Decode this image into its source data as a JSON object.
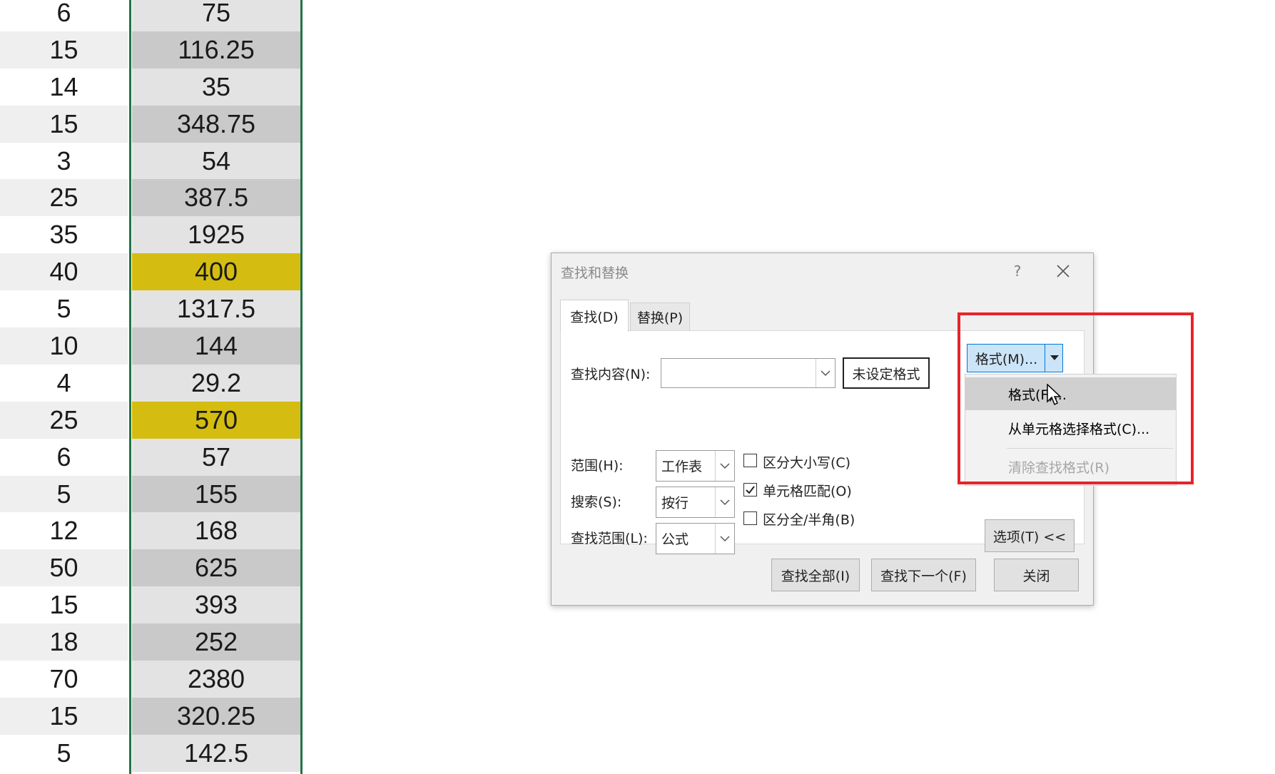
{
  "sheet": {
    "rows": [
      {
        "qty": "6",
        "amount": "75",
        "highlight": false
      },
      {
        "qty": "15",
        "amount": "116.25",
        "highlight": false
      },
      {
        "qty": "14",
        "amount": "35",
        "highlight": false
      },
      {
        "qty": "15",
        "amount": "348.75",
        "highlight": false
      },
      {
        "qty": "3",
        "amount": "54",
        "highlight": false
      },
      {
        "qty": "25",
        "amount": "387.5",
        "highlight": false
      },
      {
        "qty": "35",
        "amount": "1925",
        "highlight": false
      },
      {
        "qty": "40",
        "amount": "400",
        "highlight": true
      },
      {
        "qty": "5",
        "amount": "1317.5",
        "highlight": false
      },
      {
        "qty": "10",
        "amount": "144",
        "highlight": false
      },
      {
        "qty": "4",
        "amount": "29.2",
        "highlight": false
      },
      {
        "qty": "25",
        "amount": "570",
        "highlight": true
      },
      {
        "qty": "6",
        "amount": "57",
        "highlight": false
      },
      {
        "qty": "5",
        "amount": "155",
        "highlight": false
      },
      {
        "qty": "12",
        "amount": "168",
        "highlight": false
      },
      {
        "qty": "50",
        "amount": "625",
        "highlight": false
      },
      {
        "qty": "15",
        "amount": "393",
        "highlight": false
      },
      {
        "qty": "18",
        "amount": "252",
        "highlight": false
      },
      {
        "qty": "70",
        "amount": "2380",
        "highlight": false
      },
      {
        "qty": "15",
        "amount": "320.25",
        "highlight": false
      },
      {
        "qty": "5",
        "amount": "142.5",
        "highlight": false
      }
    ],
    "highlight_color": "#d4bd10",
    "selection_border_color": "#217346"
  },
  "dialog": {
    "title": "查找和替换",
    "help": "?",
    "tabs": {
      "find": "查找(D)",
      "replace": "替换(P)"
    },
    "find_what_label": "查找内容(N):",
    "find_what_value": "",
    "no_format_label": "未设定格式",
    "format_button_label": "格式(M)...",
    "within_label": "范围(H):",
    "within_value": "工作表",
    "search_label": "搜索(S):",
    "search_value": "按行",
    "look_in_label": "查找范围(L):",
    "look_in_value": "公式",
    "match_case_label": "区分大小写(C)",
    "match_case_checked": false,
    "match_entire_label": "单元格匹配(O)",
    "match_entire_checked": true,
    "match_byte_label": "区分全/半角(B)",
    "match_byte_checked": false,
    "options_button": "选项(T) <<",
    "find_all_button": "查找全部(I)",
    "find_next_button": "查找下一个(F)",
    "close_button": "关闭"
  },
  "format_menu": {
    "items": [
      "格式(F)...",
      "从单元格选择格式(C)...",
      "清除查找格式(R)"
    ],
    "highlighted_item": "格式(F)...",
    "disabled_item": "清除查找格式(R)"
  },
  "annotation": {
    "box_color": "#e8232a"
  }
}
